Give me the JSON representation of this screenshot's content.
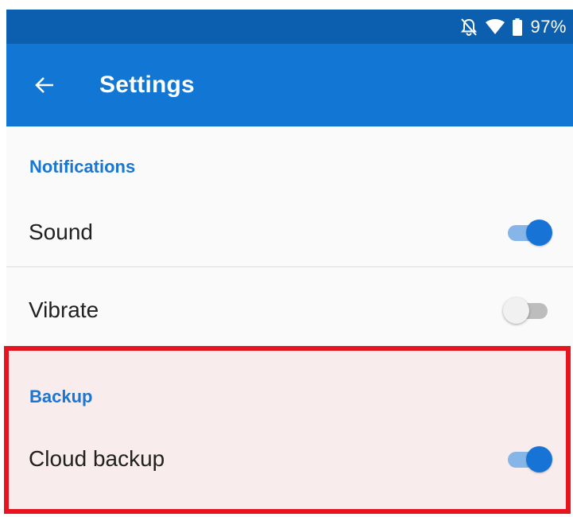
{
  "status_bar": {
    "icons": [
      "notifications-off-icon",
      "wifi-icon",
      "battery-icon"
    ],
    "battery_percent": "97%"
  },
  "app_bar": {
    "back_icon": "arrow-back-icon",
    "title": "Settings"
  },
  "sections": {
    "notifications": {
      "header": "Notifications",
      "sound": {
        "label": "Sound",
        "enabled": true
      },
      "vibrate": {
        "label": "Vibrate",
        "enabled": false
      }
    },
    "backup": {
      "header": "Backup",
      "cloud_backup": {
        "label": "Cloud backup",
        "enabled": true
      }
    }
  },
  "colors": {
    "status_bar": "#0b5fae",
    "app_bar": "#1176d4",
    "accent": "#1976d2",
    "highlight_border": "#e5141e",
    "highlight_fill": "#f9ecec"
  }
}
